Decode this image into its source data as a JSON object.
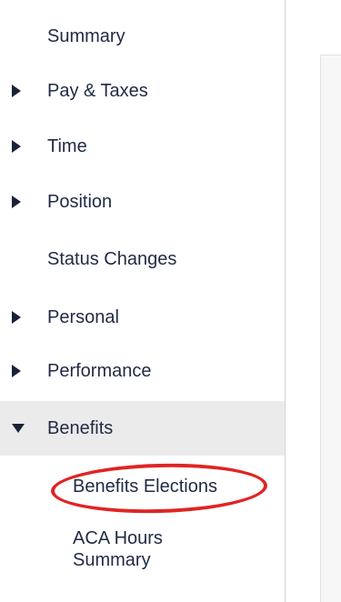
{
  "sidebar": {
    "items": [
      {
        "label": "Summary",
        "expandable": false
      },
      {
        "label": "Pay & Taxes",
        "expandable": true,
        "expanded": false
      },
      {
        "label": "Time",
        "expandable": true,
        "expanded": false
      },
      {
        "label": "Position",
        "expandable": true,
        "expanded": false
      },
      {
        "label": "Status Changes",
        "expandable": false
      },
      {
        "label": "Personal",
        "expandable": true,
        "expanded": false
      },
      {
        "label": "Performance",
        "expandable": true,
        "expanded": false
      },
      {
        "label": "Benefits",
        "expandable": true,
        "expanded": true,
        "active": true
      }
    ],
    "benefits_children": [
      {
        "label": "Benefits Elections",
        "highlighted": true
      },
      {
        "label": "ACA Hours Summary"
      }
    ]
  },
  "icons": {
    "collapsed": "caret-right-icon",
    "expanded": "caret-down-icon"
  },
  "colors": {
    "text": "#1f2a44",
    "active_bg": "#ebebeb",
    "highlight": "#e02424",
    "divider": "#d3d3d3"
  }
}
